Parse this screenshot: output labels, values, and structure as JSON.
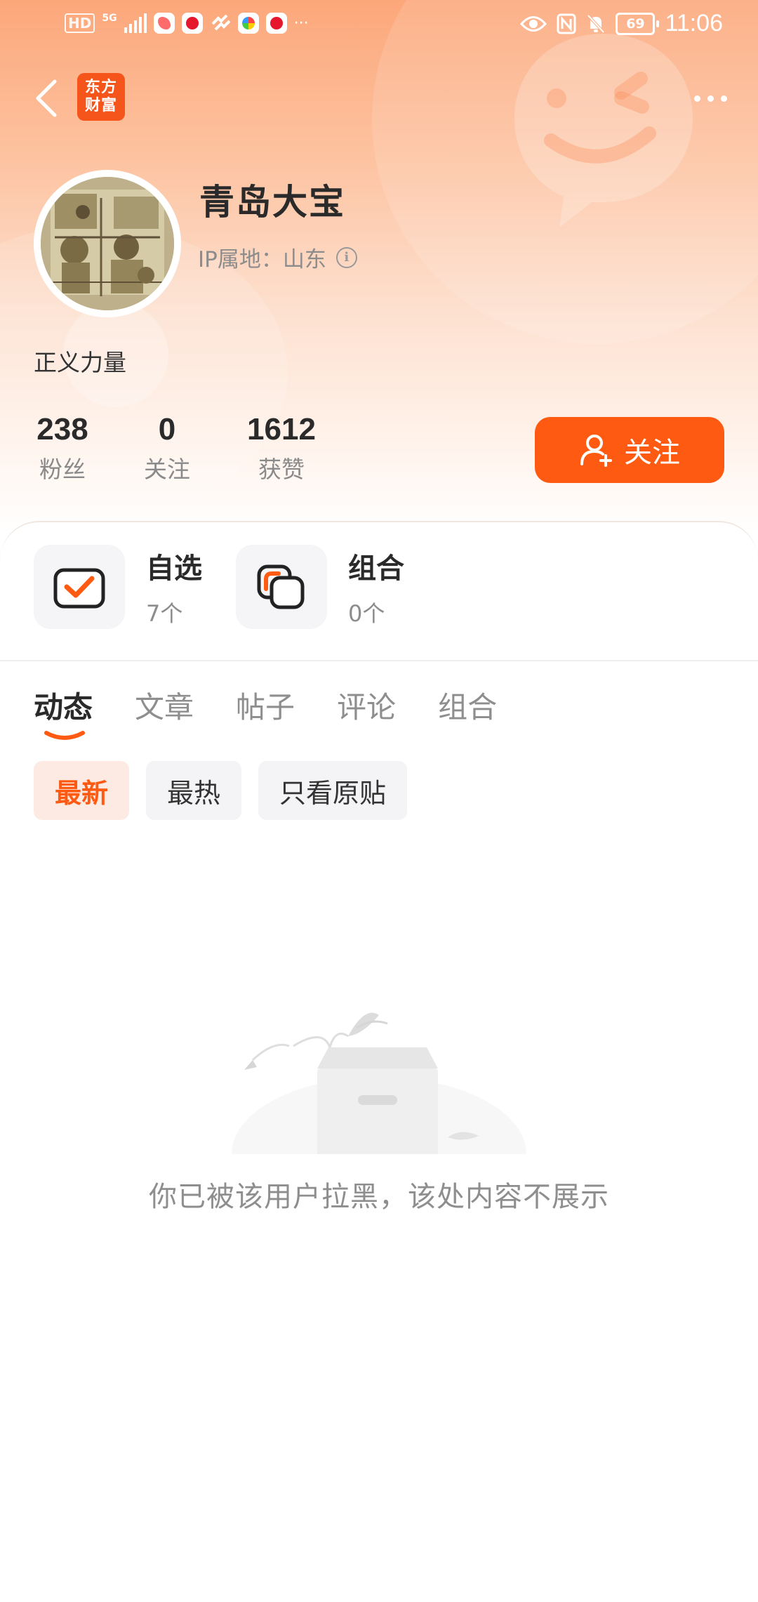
{
  "status_bar": {
    "network": "HD",
    "signal_label": "5G",
    "battery": "69",
    "time": "11:06",
    "more_notifications": "···"
  },
  "nav": {
    "logo_line1": "东方",
    "logo_line2": "财富",
    "brand_color": "#F5541A"
  },
  "profile": {
    "username": "青岛大宝",
    "ip_location": "IP属地：山东",
    "bio": "正义力量",
    "stats": [
      {
        "value": "238",
        "label": "粉丝"
      },
      {
        "value": "0",
        "label": "关注"
      },
      {
        "value": "1612",
        "label": "获赞"
      }
    ],
    "follow_label": "关注",
    "accent_color": "#FF5A12"
  },
  "quick": [
    {
      "title": "自选",
      "count": "7个",
      "icon": "checkbox-icon"
    },
    {
      "title": "组合",
      "count": "0个",
      "icon": "portfolio-icon"
    }
  ],
  "tabs": [
    {
      "label": "动态",
      "active": true
    },
    {
      "label": "文章",
      "active": false
    },
    {
      "label": "帖子",
      "active": false
    },
    {
      "label": "评论",
      "active": false
    },
    {
      "label": "组合",
      "active": false
    }
  ],
  "filters": [
    {
      "label": "最新",
      "active": true
    },
    {
      "label": "最热",
      "active": false
    },
    {
      "label": "只看原贴",
      "active": false
    }
  ],
  "empty_state": {
    "message": "你已被该用户拉黑，该处内容不展示",
    "icon": "empty-box-icon"
  }
}
